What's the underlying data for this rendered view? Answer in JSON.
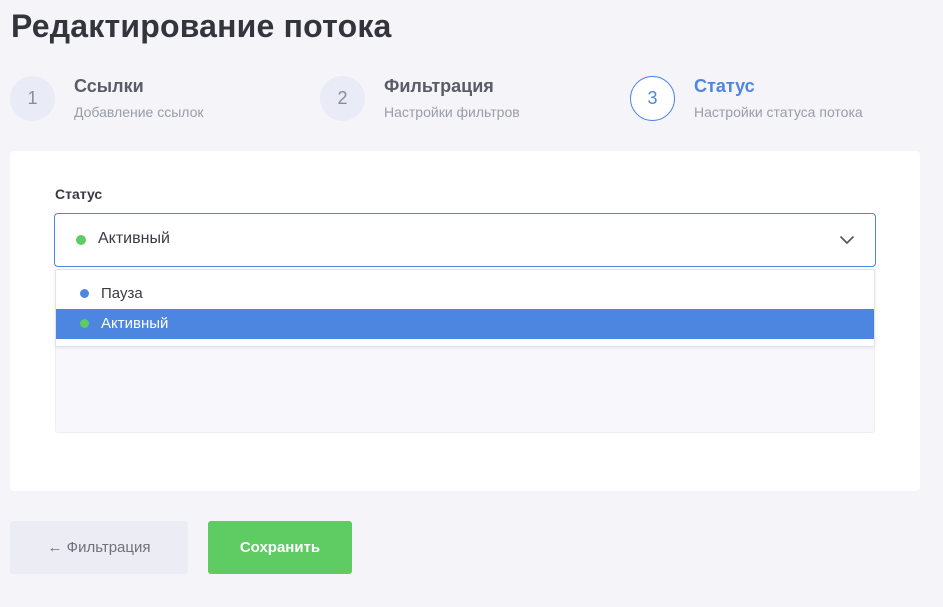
{
  "page": {
    "title": "Редактирование потока"
  },
  "steps": [
    {
      "number": "1",
      "title": "Ссылки",
      "subtitle": "Добавление ссылок",
      "active": false
    },
    {
      "number": "2",
      "title": "Фильтрация",
      "subtitle": "Настройки фильтров",
      "active": false
    },
    {
      "number": "3",
      "title": "Статус",
      "subtitle": "Настройки статуса потока",
      "active": true
    }
  ],
  "status_field": {
    "label": "Статус",
    "selected_value": "Активный",
    "selected_dot_color": "#5ecb63",
    "options": [
      {
        "label": "Пауза",
        "dot_color": "#4d86e0",
        "selected": false
      },
      {
        "label": "Активный",
        "dot_color": "#5ecb63",
        "selected": true
      }
    ]
  },
  "buttons": {
    "back_label": "← Фильтрация",
    "save_label": "Сохранить"
  },
  "colors": {
    "accent": "#4d86e0",
    "success": "#5ecb63",
    "background": "#f4f4f9"
  }
}
